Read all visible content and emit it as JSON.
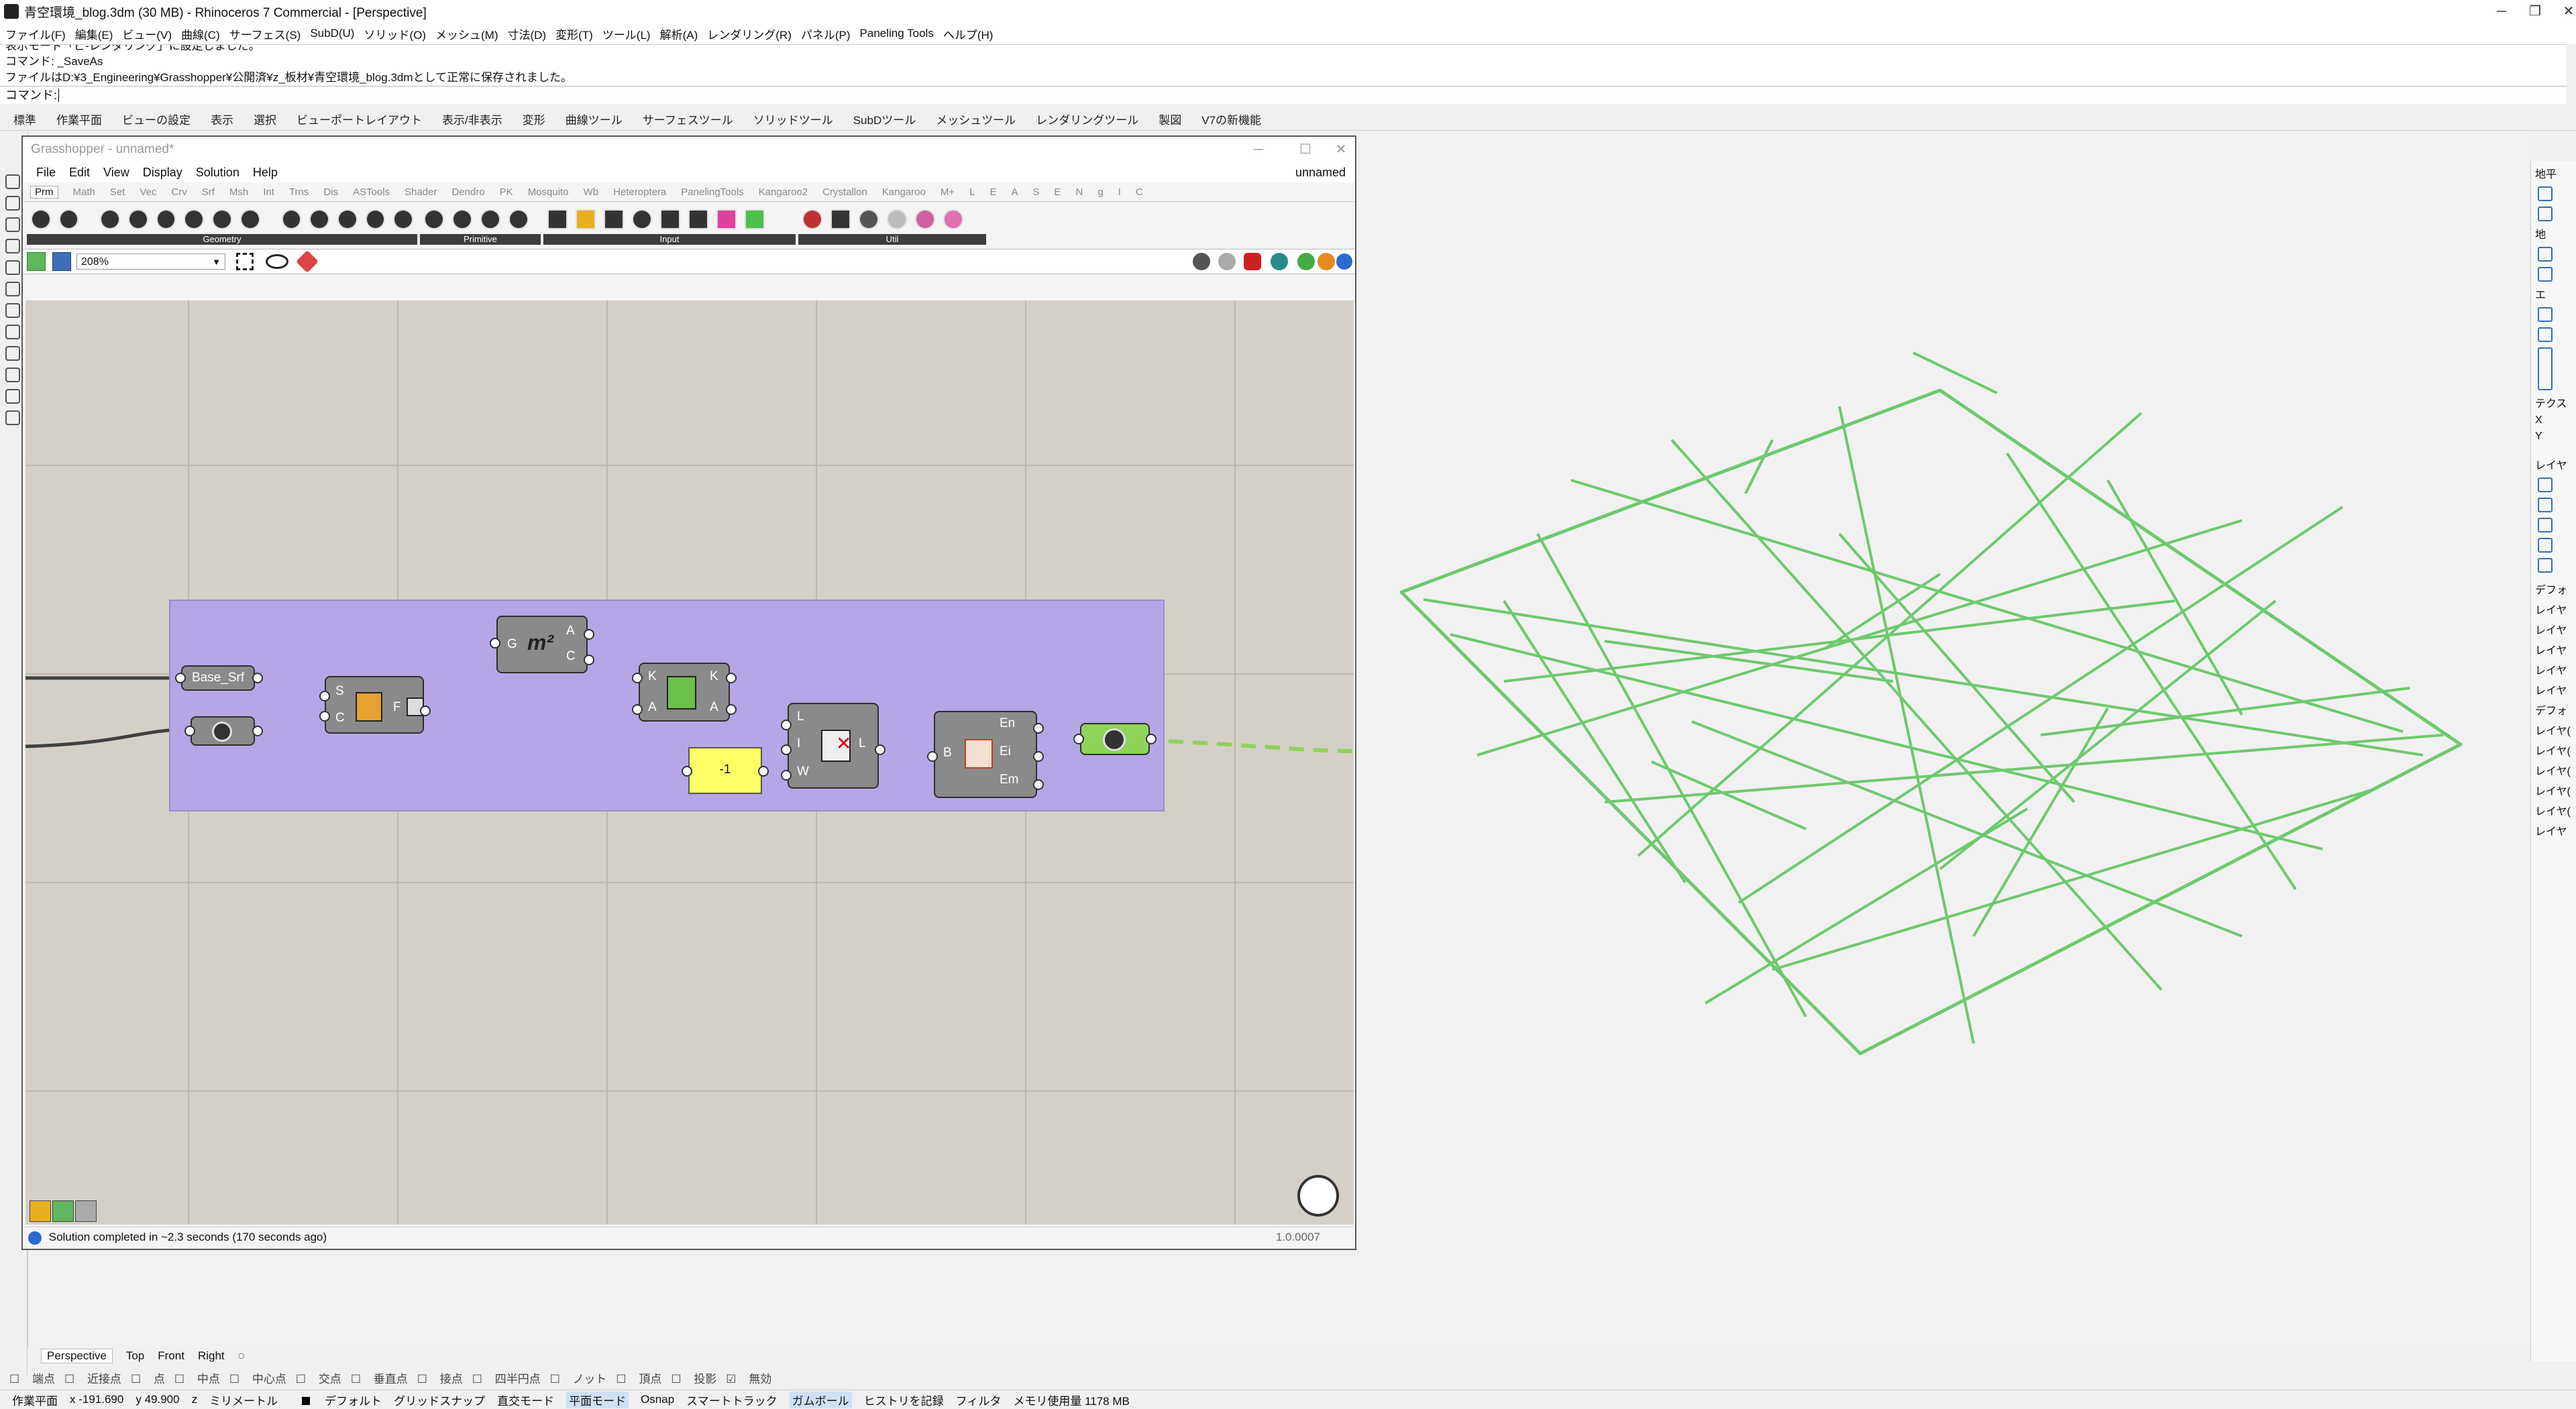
{
  "titlebar": {
    "title": "青空環境_blog.3dm (30 MB) - Rhinoceros 7 Commercial - [Perspective]"
  },
  "menu": [
    "ファイル(F)",
    "編集(E)",
    "ビュー(V)",
    "曲線(C)",
    "サーフェス(S)",
    "SubD(U)",
    "ソリッド(O)",
    "メッシュ(M)",
    "寸法(D)",
    "変形(T)",
    "ツール(L)",
    "解析(A)",
    "レンダリング(R)",
    "パネル(P)",
    "Paneling Tools",
    "ヘルプ(H)"
  ],
  "command": {
    "history": [
      "表示モード「ピ-レンダリング」に設定しました。",
      "コマンド: _SaveAs",
      "ファイルはD:¥3_Engineering¥Grasshopper¥公開済¥z_板材¥青空環境_blog.3dmとして正常に保存されました。"
    ],
    "prompt": "コマンド:"
  },
  "toolbar_tabs": [
    "標準",
    "作業平面",
    "ビューの設定",
    "表示",
    "選択",
    "ビューポートレイアウト",
    "表示/非表示",
    "変形",
    "曲線ツール",
    "サーフェスツール",
    "ソリッドツール",
    "SubDツール",
    "メッシュツール",
    "レンダリングツール",
    "製図",
    "V7の新機能"
  ],
  "grasshopper": {
    "title": "Grasshopper - unnamed*",
    "menu": [
      "File",
      "Edit",
      "View",
      "Display",
      "Solution",
      "Help"
    ],
    "doc_name": "unnamed",
    "component_tabs": [
      "Prm",
      "Math",
      "Set",
      "Vec",
      "Crv",
      "Srf",
      "Msh",
      "Int",
      "Trns",
      "Dis",
      "ASTools",
      "Shader",
      "Dendro",
      "PK",
      "Mosquito",
      "Wb",
      "Heteroptera",
      "PanelingTools",
      "Kangaroo2",
      "Crystallon",
      "Kangaroo",
      "M+",
      "L",
      "E",
      "A",
      "S",
      "E",
      "N",
      "g",
      "I",
      "C"
    ],
    "groups": [
      "Geometry",
      "Primitive",
      "Input",
      "Util"
    ],
    "zoom": "208%",
    "components": {
      "base_srf": "Base_Srf",
      "area_inputs": "G",
      "area_outputs": [
        "A",
        "C"
      ],
      "sort_inputs": [
        "K",
        "A"
      ],
      "sort_outputs": [
        "K",
        "A"
      ],
      "divide_inputs": [
        "S",
        "C"
      ],
      "divide_output": "F",
      "panel_value": "-1",
      "cull_inputs": [
        "L",
        "I",
        "W"
      ],
      "cull_output": "L",
      "brep_input": "B",
      "brep_outputs": [
        "En",
        "Ei",
        "Em"
      ]
    },
    "status": "Solution completed in ~2.3 seconds (170 seconds ago)",
    "version": "1.0.0007"
  },
  "right_panel": {
    "labels": [
      "地平",
      "地",
      "エ",
      "テクス",
      "X",
      "Y",
      "レイヤ"
    ],
    "layers": [
      "デフォ",
      "レイヤ",
      "レイヤ",
      "レイヤ",
      "レイヤ",
      "レイヤ",
      "デフォ",
      "レイヤ(",
      "レイヤ(",
      "レイヤ(",
      "レイヤ(",
      "レイヤ(",
      "レイヤ"
    ]
  },
  "viewport_tabs": [
    "Perspective",
    "Top",
    "Front",
    "Right"
  ],
  "osnap": [
    "端点",
    "近接点",
    "点",
    "中点",
    "中心点",
    "交点",
    "垂直点",
    "接点",
    "四半円点",
    "ノット",
    "頂点",
    "投影",
    "無効"
  ],
  "statusbar": {
    "cplane": "作業平面",
    "x": "x -191.690",
    "y": "y 49.900",
    "z": "z",
    "units": "ミリメートル",
    "layer": "デフォルト",
    "toggles": [
      "グリッドスナップ",
      "直交モード",
      "平面モード",
      "Osnap",
      "スマートトラック",
      "ガムボール",
      "ヒストリを記録",
      "フィルタ"
    ],
    "memory": "メモリ使用量 1178 MB"
  },
  "colors": {
    "accent": "#6ec96e",
    "group": "#b6a6e6",
    "panel": "#ffff66",
    "preview": "#8fd35a"
  }
}
